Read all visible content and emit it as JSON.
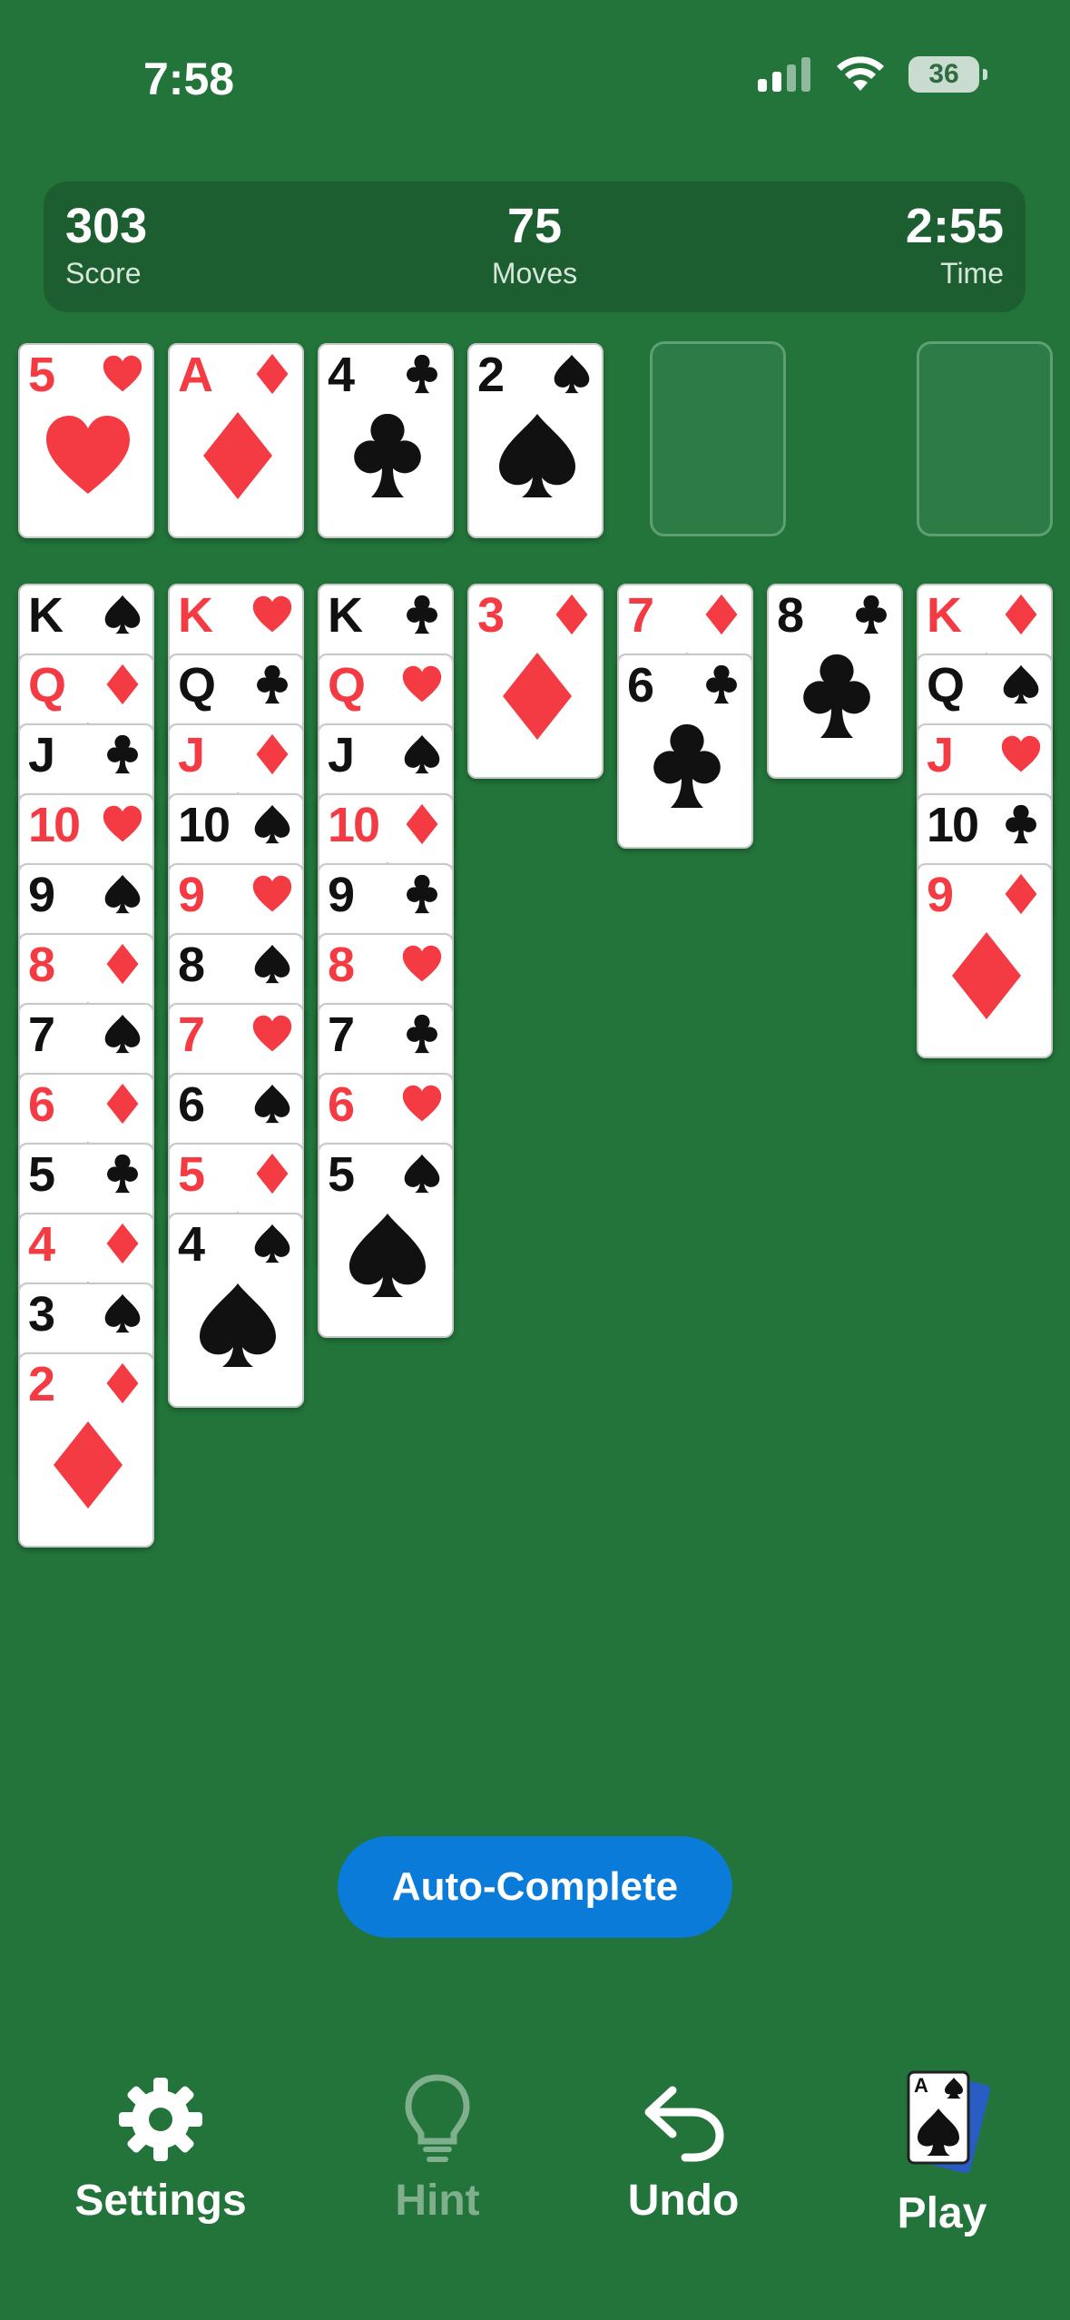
{
  "status_bar": {
    "time": "7:58",
    "battery": "36"
  },
  "stats": {
    "score": {
      "value": "303",
      "label": "Score"
    },
    "moves": {
      "value": "75",
      "label": "Moves"
    },
    "time": {
      "value": "2:55",
      "label": "Time"
    }
  },
  "foundations": [
    {
      "rank": "5",
      "suit": "hearts"
    },
    {
      "rank": "A",
      "suit": "diamonds"
    },
    {
      "rank": "4",
      "suit": "clubs"
    },
    {
      "rank": "2",
      "suit": "spades"
    }
  ],
  "free_cells": [
    "empty",
    "empty"
  ],
  "tableau": [
    [
      {
        "rank": "K",
        "suit": "spades"
      },
      {
        "rank": "Q",
        "suit": "diamonds"
      },
      {
        "rank": "J",
        "suit": "clubs"
      },
      {
        "rank": "10",
        "suit": "hearts"
      },
      {
        "rank": "9",
        "suit": "spades"
      },
      {
        "rank": "8",
        "suit": "diamonds"
      },
      {
        "rank": "7",
        "suit": "spades"
      },
      {
        "rank": "6",
        "suit": "diamonds"
      },
      {
        "rank": "5",
        "suit": "clubs"
      },
      {
        "rank": "4",
        "suit": "diamonds"
      },
      {
        "rank": "3",
        "suit": "spades"
      },
      {
        "rank": "2",
        "suit": "diamonds"
      }
    ],
    [
      {
        "rank": "K",
        "suit": "hearts"
      },
      {
        "rank": "Q",
        "suit": "clubs"
      },
      {
        "rank": "J",
        "suit": "diamonds"
      },
      {
        "rank": "10",
        "suit": "spades"
      },
      {
        "rank": "9",
        "suit": "hearts"
      },
      {
        "rank": "8",
        "suit": "spades"
      },
      {
        "rank": "7",
        "suit": "hearts"
      },
      {
        "rank": "6",
        "suit": "spades"
      },
      {
        "rank": "5",
        "suit": "diamonds"
      },
      {
        "rank": "4",
        "suit": "spades"
      }
    ],
    [
      {
        "rank": "K",
        "suit": "clubs"
      },
      {
        "rank": "Q",
        "suit": "hearts"
      },
      {
        "rank": "J",
        "suit": "spades"
      },
      {
        "rank": "10",
        "suit": "diamonds"
      },
      {
        "rank": "9",
        "suit": "clubs"
      },
      {
        "rank": "8",
        "suit": "hearts"
      },
      {
        "rank": "7",
        "suit": "clubs"
      },
      {
        "rank": "6",
        "suit": "hearts"
      },
      {
        "rank": "5",
        "suit": "spades"
      }
    ],
    [
      {
        "rank": "3",
        "suit": "diamonds"
      }
    ],
    [
      {
        "rank": "7",
        "suit": "diamonds"
      },
      {
        "rank": "6",
        "suit": "clubs"
      }
    ],
    [
      {
        "rank": "8",
        "suit": "clubs"
      }
    ],
    [
      {
        "rank": "K",
        "suit": "diamonds"
      },
      {
        "rank": "Q",
        "suit": "spades"
      },
      {
        "rank": "J",
        "suit": "hearts"
      },
      {
        "rank": "10",
        "suit": "clubs"
      },
      {
        "rank": "9",
        "suit": "diamonds"
      }
    ]
  ],
  "auto_complete_label": "Auto-Complete",
  "toolbar": {
    "settings": "Settings",
    "hint": "Hint",
    "undo": "Undo",
    "play": "Play",
    "play_card": {
      "rank": "A",
      "suit": "spades"
    }
  },
  "colors": {
    "felt": "#22743a",
    "red_suit": "#f43b43",
    "button_blue": "#0a7bd8"
  }
}
